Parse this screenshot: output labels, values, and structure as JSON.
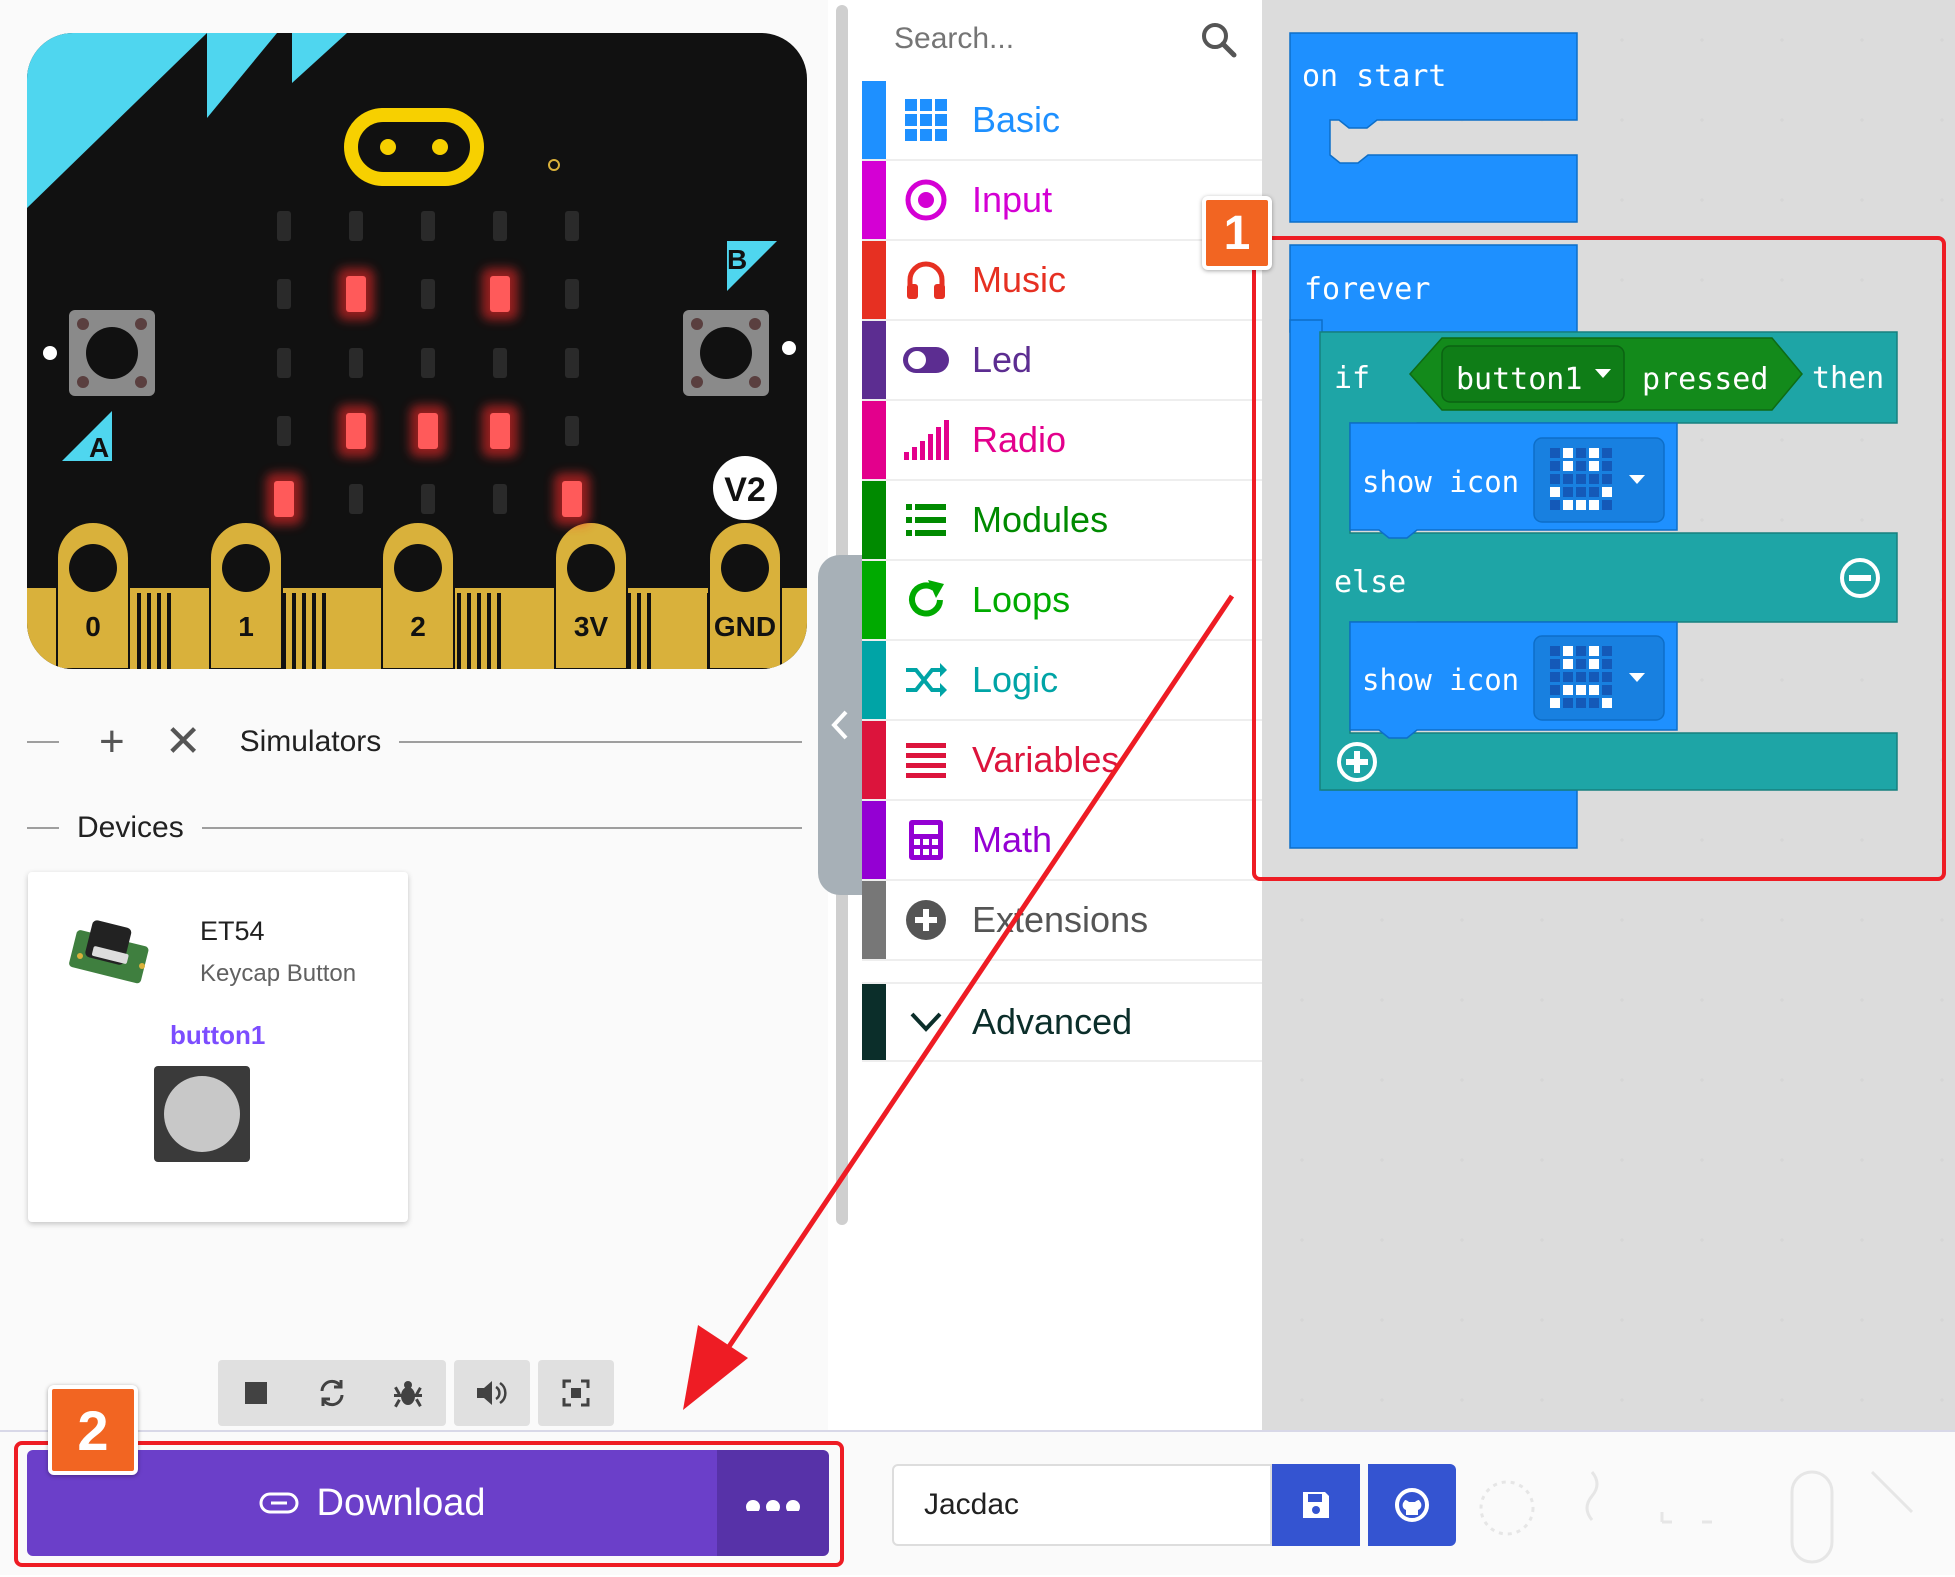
{
  "simulator": {
    "board": {
      "logo": "micro:bit",
      "version_badge": "V2",
      "button_a": "A",
      "button_b": "B",
      "pins": [
        "0",
        "1",
        "2",
        "3V",
        "GND"
      ],
      "led_matrix": [
        [
          0,
          0,
          0,
          0,
          0
        ],
        [
          0,
          1,
          0,
          1,
          0
        ],
        [
          0,
          0,
          0,
          0,
          0
        ],
        [
          0,
          1,
          1,
          1,
          0
        ],
        [
          1,
          0,
          0,
          0,
          1
        ]
      ]
    },
    "section_simulators": "Simulators",
    "section_devices": "Devices",
    "device": {
      "name": "ET54",
      "description": "Keycap Button",
      "instance": "button1"
    },
    "toolbar": [
      "stop-icon",
      "restart-icon",
      "debug-icon",
      "mute-icon",
      "fullscreen-icon"
    ]
  },
  "toolbox": {
    "search_placeholder": "Search...",
    "categories": [
      {
        "label": "Basic",
        "color": "#1e90ff",
        "icon": "grid-icon"
      },
      {
        "label": "Input",
        "color": "#d400d4",
        "icon": "target-icon"
      },
      {
        "label": "Music",
        "color": "#e63022",
        "icon": "headphones-icon"
      },
      {
        "label": "Led",
        "color": "#5c2d91",
        "icon": "toggle-icon"
      },
      {
        "label": "Radio",
        "color": "#e3008c",
        "icon": "signal-bars-icon"
      },
      {
        "label": "Modules",
        "color": "#008a00",
        "icon": "list-icon"
      },
      {
        "label": "Loops",
        "color": "#00aa00",
        "icon": "refresh-icon"
      },
      {
        "label": "Logic",
        "color": "#00a4a6",
        "icon": "shuffle-icon"
      },
      {
        "label": "Variables",
        "color": "#dc143c",
        "icon": "lines-icon"
      },
      {
        "label": "Math",
        "color": "#9400d3",
        "icon": "calculator-icon"
      },
      {
        "label": "Extensions",
        "color": "#777777",
        "icon": "plus-circle-icon"
      }
    ],
    "advanced": {
      "label": "Advanced",
      "color": "#0b2e2a"
    }
  },
  "workspace": {
    "on_start": "on start",
    "forever": "forever",
    "if_kw": "if",
    "dropdown": "button1",
    "pressed": "pressed",
    "then_kw": "then",
    "else_kw": "else",
    "show_icon_1": "show icon",
    "show_icon_2": "show icon",
    "icon_1": [
      [
        0,
        1,
        0,
        1,
        0
      ],
      [
        0,
        1,
        0,
        1,
        0
      ],
      [
        0,
        0,
        0,
        0,
        0
      ],
      [
        1,
        0,
        0,
        0,
        1
      ],
      [
        0,
        1,
        1,
        1,
        0
      ]
    ],
    "icon_2": [
      [
        0,
        1,
        0,
        1,
        0
      ],
      [
        0,
        1,
        0,
        1,
        0
      ],
      [
        0,
        0,
        0,
        0,
        0
      ],
      [
        0,
        1,
        1,
        1,
        0
      ],
      [
        1,
        0,
        0,
        0,
        1
      ]
    ],
    "colors": {
      "event": "#1e90ff",
      "logic": "#1ea5a6",
      "bool": "#138a1b"
    }
  },
  "annotations": {
    "badge_1": "1",
    "badge_2": "2"
  },
  "bottom": {
    "download_label": "Download",
    "project_name": "Jacdac"
  }
}
